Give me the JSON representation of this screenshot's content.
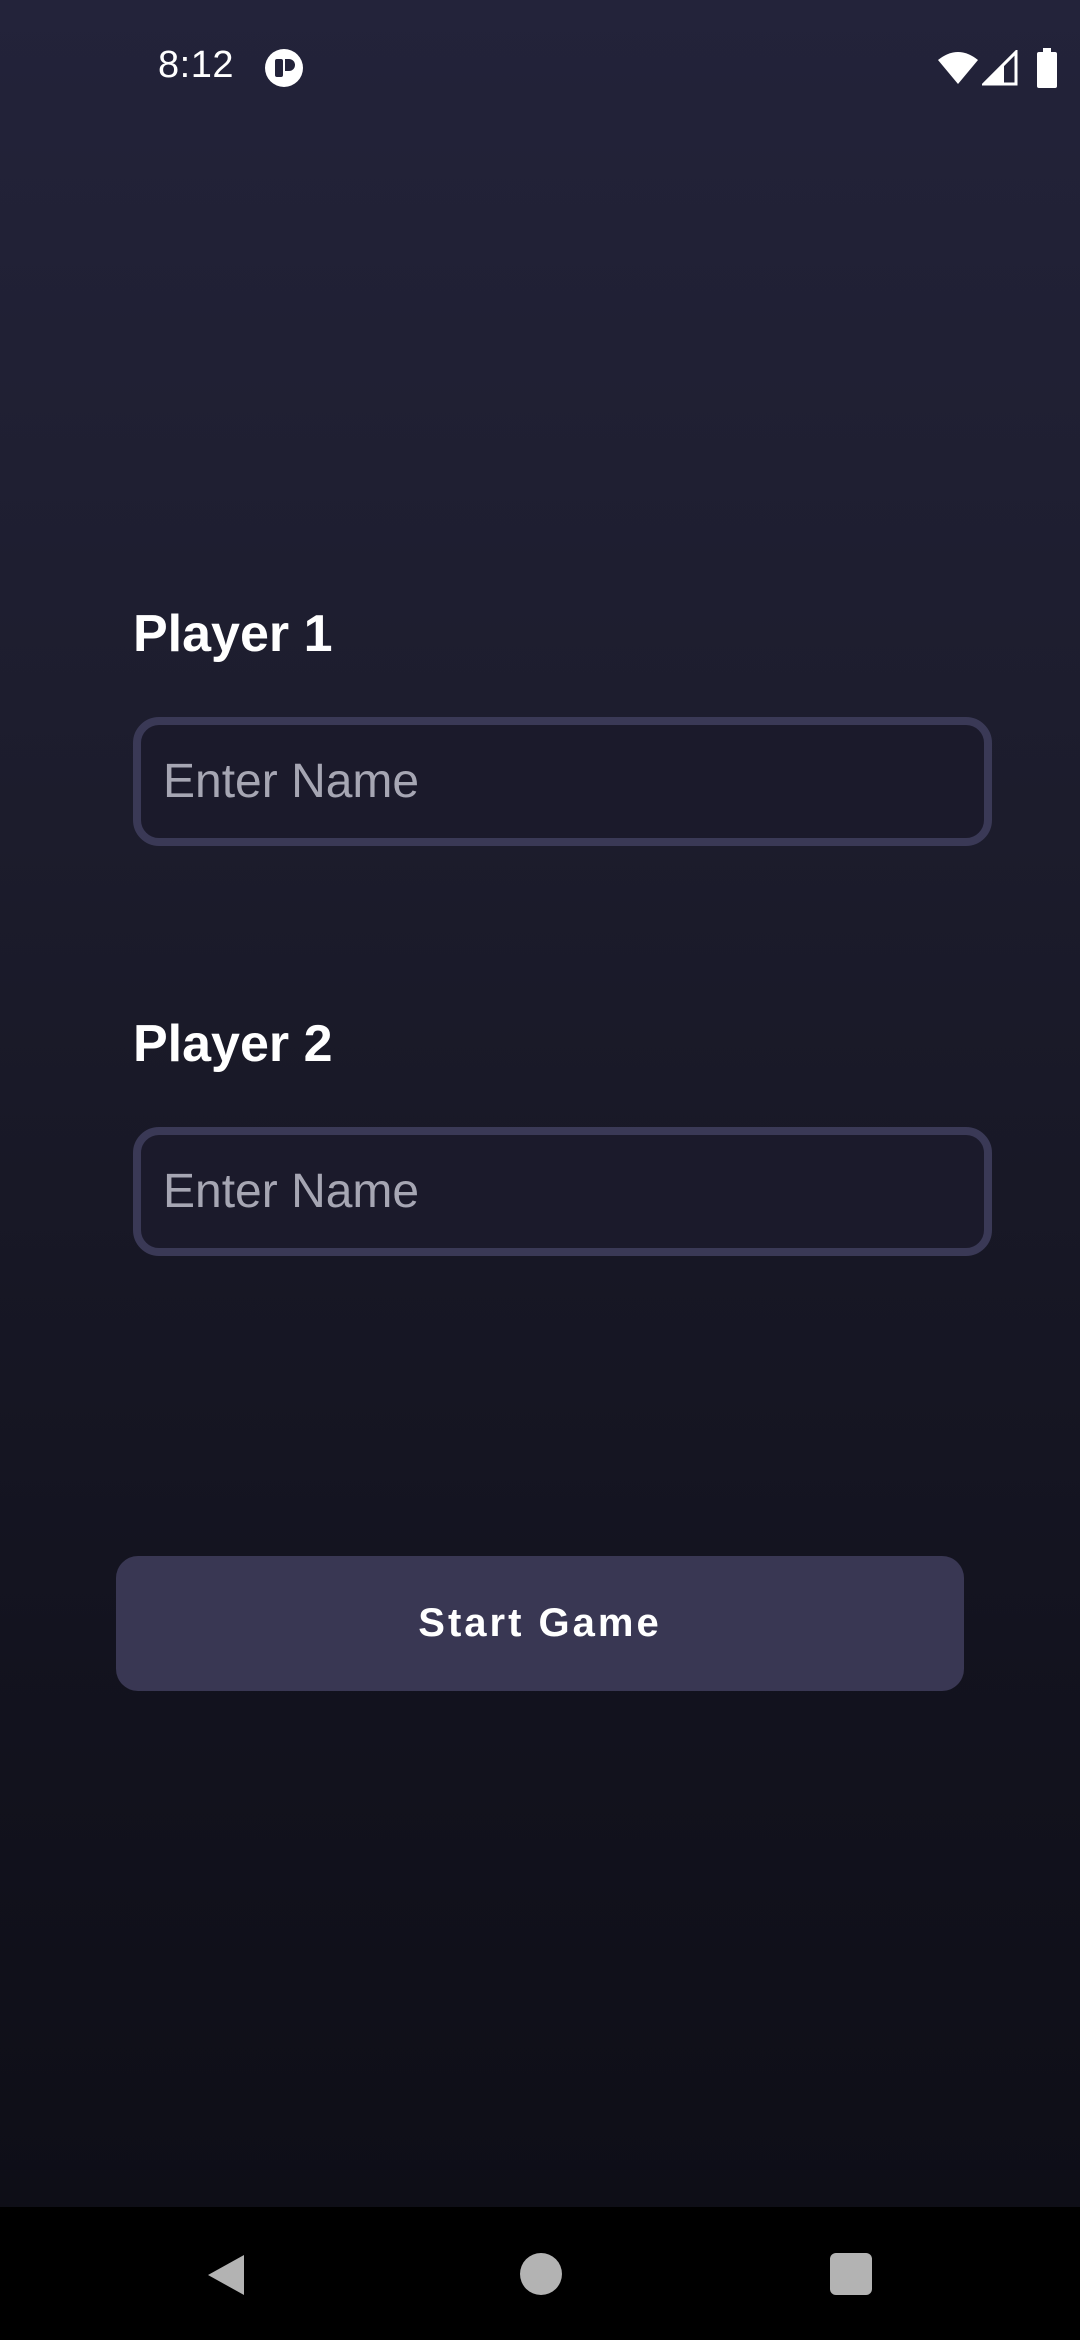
{
  "status_bar": {
    "time": "8:12",
    "icons": [
      "app-notification-icon",
      "wifi-icon",
      "signal-icon",
      "battery-icon"
    ]
  },
  "form": {
    "player1": {
      "label": "Player 1",
      "placeholder": "Enter Name",
      "value": ""
    },
    "player2": {
      "label": "Player 2",
      "placeholder": "Enter Name",
      "value": ""
    },
    "start_button_label": "Start Game"
  },
  "nav_bar": {
    "icons": [
      "back-icon",
      "home-icon",
      "recents-icon"
    ]
  },
  "colors": {
    "background_top": "#23233a",
    "background_bottom": "#0d0d15",
    "field_border": "#3a3956",
    "button_bg": "#393753"
  }
}
